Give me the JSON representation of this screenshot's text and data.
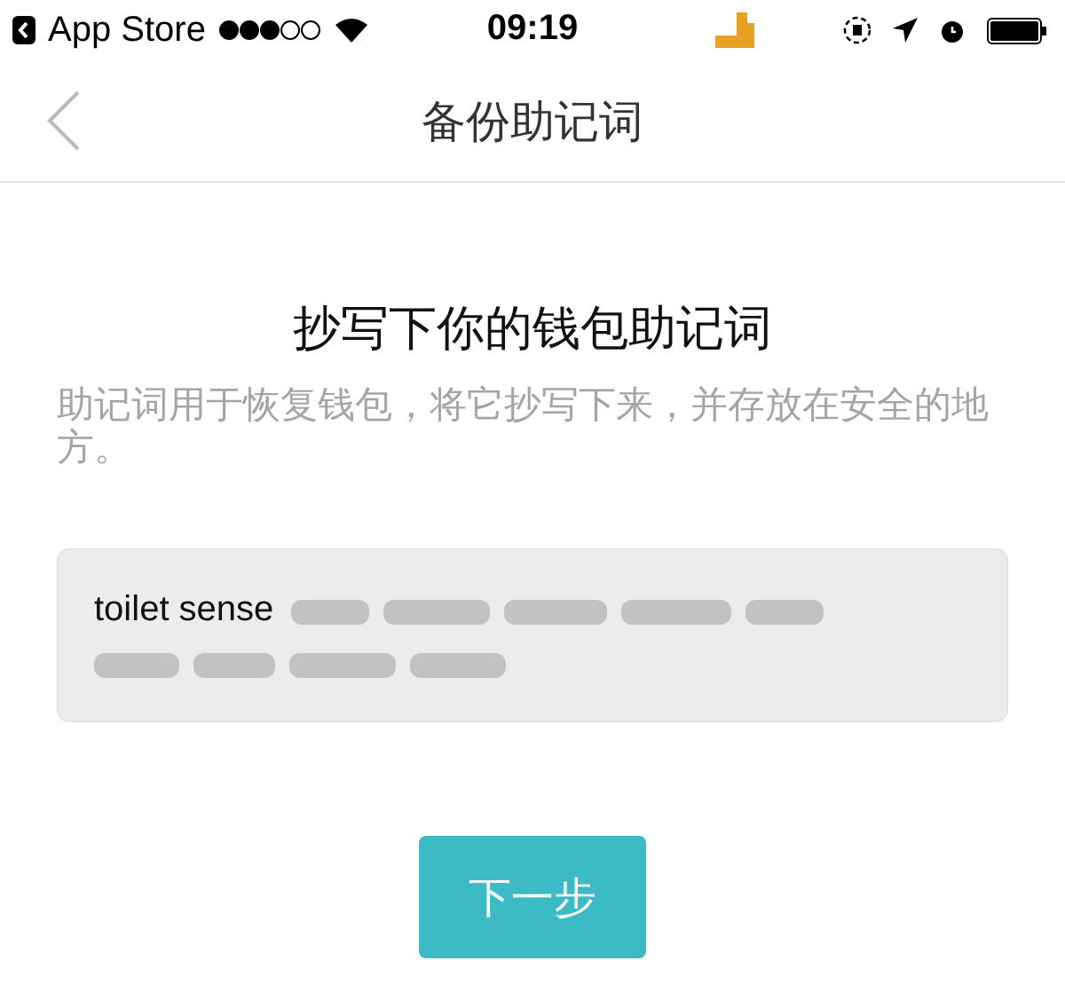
{
  "status_bar": {
    "back_label": "App Store",
    "time": "09:19"
  },
  "nav_bar": {
    "title": "备份助记词"
  },
  "heading": "抄写下你的钱包助记词",
  "description": "助记词用于恢复钱包，将它抄写下来，并存放在安全的地方。",
  "mnemonic": {
    "visible": "toilet sense"
  },
  "buttons": [
    "下一步"
  ]
}
